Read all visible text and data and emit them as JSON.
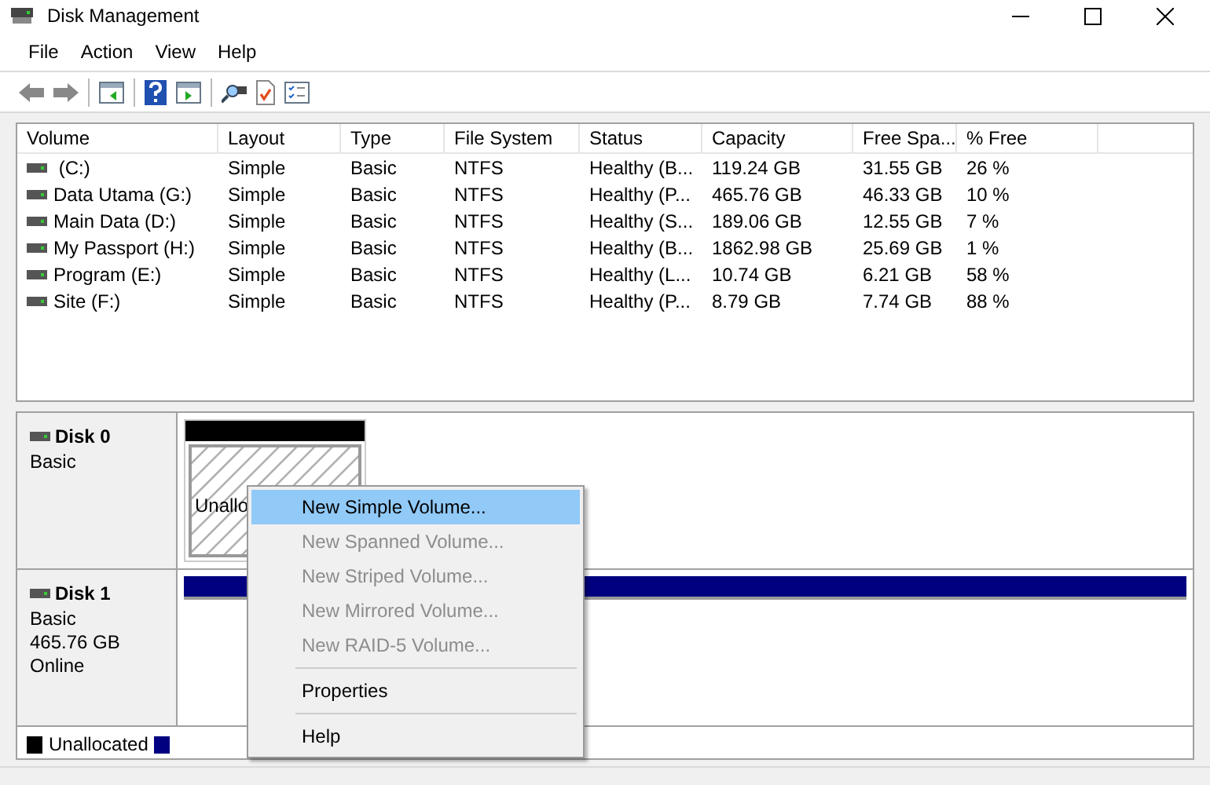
{
  "window": {
    "title": "Disk Management"
  },
  "menu": [
    "File",
    "Action",
    "View",
    "Help"
  ],
  "table": {
    "columns": [
      "Volume",
      "Layout",
      "Type",
      "File System",
      "Status",
      "Capacity",
      "Free Spa...",
      "% Free"
    ],
    "rows": [
      {
        "cells": [
          " (C:)",
          "Simple",
          "Basic",
          "NTFS",
          "Healthy (B...",
          "119.24 GB",
          "31.55 GB",
          "26 %"
        ]
      },
      {
        "cells": [
          "Data Utama (G:)",
          "Simple",
          "Basic",
          "NTFS",
          "Healthy (P...",
          "465.76 GB",
          "46.33 GB",
          "10 %"
        ]
      },
      {
        "cells": [
          "Main Data (D:)",
          "Simple",
          "Basic",
          "NTFS",
          "Healthy (S...",
          "189.06 GB",
          "12.55 GB",
          "7 %"
        ]
      },
      {
        "cells": [
          "My Passport (H:)",
          "Simple",
          "Basic",
          "NTFS",
          "Healthy (B...",
          "1862.98 GB",
          "25.69 GB",
          "1 %"
        ]
      },
      {
        "cells": [
          "Program (E:)",
          "Simple",
          "Basic",
          "NTFS",
          "Healthy (L...",
          "10.74 GB",
          "6.21 GB",
          "58 %"
        ]
      },
      {
        "cells": [
          "Site (F:)",
          "Simple",
          "Basic",
          "NTFS",
          "Healthy (P...",
          "8.79 GB",
          "7.74 GB",
          "88 %"
        ]
      }
    ]
  },
  "disks": [
    {
      "name": "Disk 0",
      "lines": [
        "Basic"
      ],
      "partition": {
        "label": "Unallo",
        "color": "#000000"
      }
    },
    {
      "name": "Disk 1",
      "lines": [
        "Basic",
        "465.76 GB",
        "Online"
      ],
      "partition": {
        "color": "#000080"
      }
    }
  ],
  "legend": [
    {
      "label": "Unallocated",
      "color": "#000000"
    },
    {
      "color": "#000080"
    }
  ],
  "context_menu": [
    {
      "label": "New Simple Volume...",
      "disabled": false,
      "selected": true
    },
    {
      "label": "New Spanned Volume...",
      "disabled": true,
      "selected": false
    },
    {
      "label": "New Striped Volume...",
      "disabled": true,
      "selected": false
    },
    {
      "label": "New Mirrored Volume...",
      "disabled": true,
      "selected": false
    },
    {
      "label": "New RAID-5 Volume...",
      "disabled": true,
      "selected": false,
      "separator_after": true
    },
    {
      "label": "Properties",
      "disabled": false,
      "selected": false,
      "separator_after": true
    },
    {
      "label": "Help",
      "disabled": false,
      "selected": false
    }
  ]
}
